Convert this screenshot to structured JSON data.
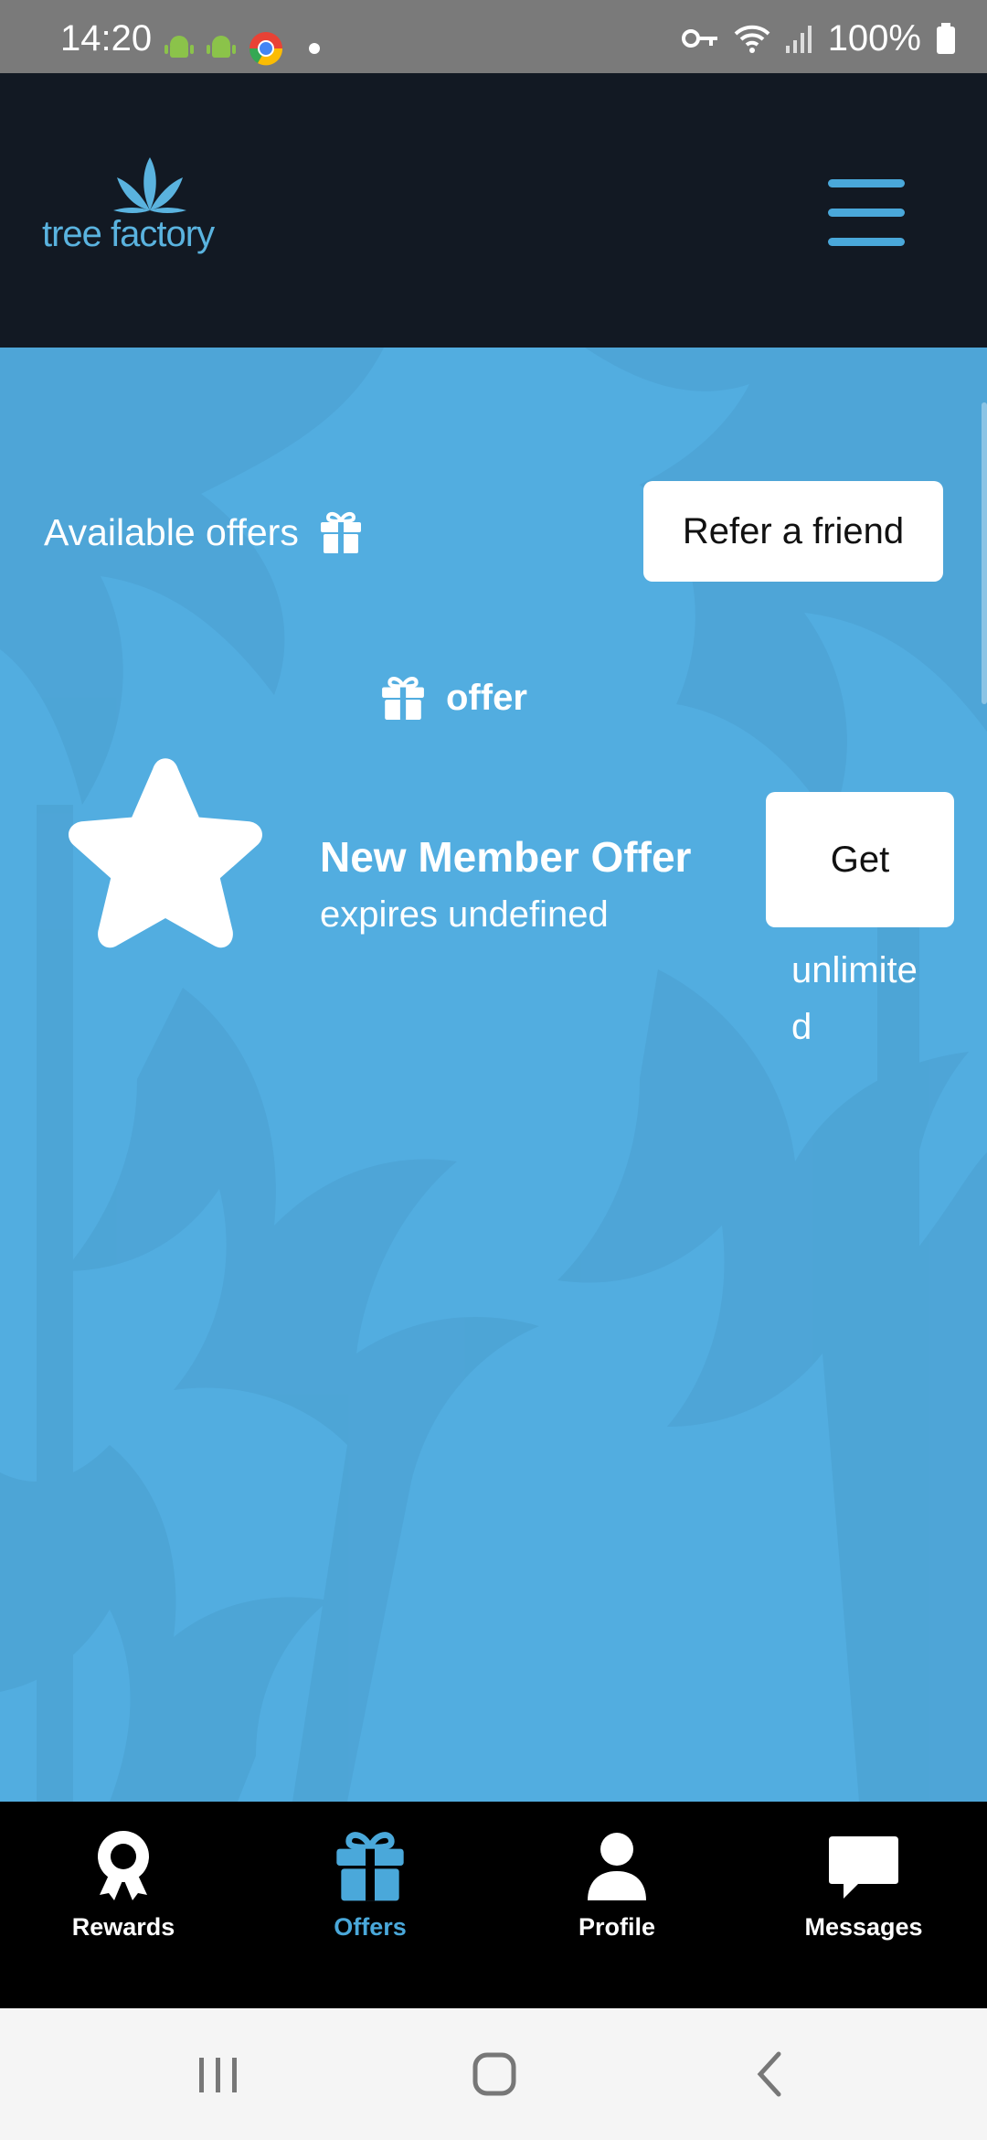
{
  "status_bar": {
    "time": "14:20",
    "battery": "100%",
    "icons": [
      "android-icon",
      "android-icon",
      "chrome-icon",
      "dot-icon",
      "key-icon",
      "wifi-icon",
      "signal-icon",
      "battery-icon"
    ]
  },
  "header": {
    "logo_text": "tree factory",
    "menu_icon": "hamburger-menu-icon"
  },
  "offers_page": {
    "available_offers_label": "Available offers",
    "refer_button_label": "Refer a friend",
    "section_label": "offer",
    "offer": {
      "title": "New Member Offer",
      "expires": "expires undefined",
      "button_label": "Get",
      "limit": "unlimited",
      "icon": "star-icon"
    }
  },
  "bottom_nav": {
    "active": "Offers",
    "active_color": "#4aa8da",
    "items": [
      {
        "label": "Rewards",
        "icon": "award-ribbon-icon"
      },
      {
        "label": "Offers",
        "icon": "gift-icon"
      },
      {
        "label": "Profile",
        "icon": "user-icon"
      },
      {
        "label": "Messages",
        "icon": "chat-bubble-icon"
      }
    ]
  },
  "colors": {
    "header_bg": "#121923",
    "content_bg": "#52ade0",
    "accent": "#4aa8da"
  }
}
